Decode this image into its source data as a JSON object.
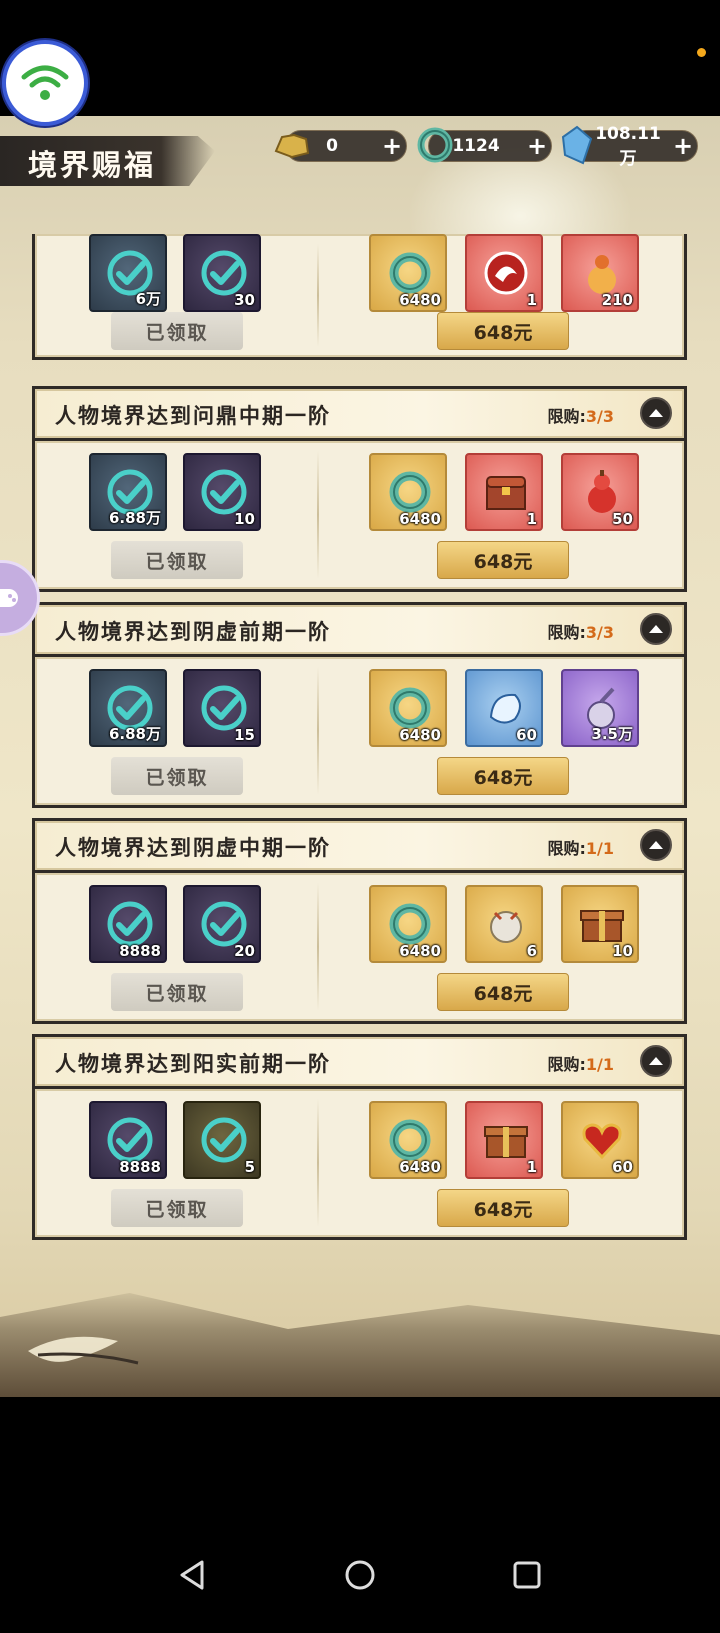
{
  "header": {
    "title": "境界赐福",
    "currencies": [
      {
        "name": "gold-ingot-icon",
        "value": "0",
        "plus": "+"
      },
      {
        "name": "jade-dragon-icon",
        "value": "1124",
        "plus": "+"
      },
      {
        "name": "spirit-crystal-icon",
        "value": "108.11万",
        "plus": "+"
      }
    ]
  },
  "cards": [
    {
      "title": "",
      "limit_label": "",
      "limit_value": "",
      "free_items": [
        {
          "name": "claimed-item-icon",
          "count": "6万",
          "style": "dark"
        },
        {
          "name": "claimed-item-icon",
          "count": "30",
          "style": "purple"
        }
      ],
      "claim_label": "已领取",
      "paid_items": [
        {
          "name": "jade-dragon-icon",
          "count": "6480",
          "style": "gold"
        },
        {
          "name": "dragon-emblem-icon",
          "count": "1",
          "style": "red"
        },
        {
          "name": "fire-gourd-icon",
          "count": "210",
          "style": "red"
        }
      ],
      "price": "648元"
    },
    {
      "title": "人物境界达到问鼎中期一阶",
      "limit_label": "限购:",
      "limit_value": "3/3",
      "free_items": [
        {
          "name": "claimed-item-icon",
          "count": "6.88万",
          "style": "dark"
        },
        {
          "name": "claimed-item-icon",
          "count": "10",
          "style": "purple"
        }
      ],
      "claim_label": "已领取",
      "paid_items": [
        {
          "name": "jade-dragon-icon",
          "count": "6480",
          "style": "gold"
        },
        {
          "name": "treasure-chest-icon",
          "count": "1",
          "style": "red"
        },
        {
          "name": "red-gourd-icon",
          "count": "50",
          "style": "red"
        }
      ],
      "price": "648元"
    },
    {
      "title": "人物境界达到阴虚前期一阶",
      "limit_label": "限购:",
      "limit_value": "3/3",
      "free_items": [
        {
          "name": "claimed-item-icon",
          "count": "6.88万",
          "style": "dark"
        },
        {
          "name": "claimed-item-icon",
          "count": "15",
          "style": "purple"
        }
      ],
      "claim_label": "已领取",
      "paid_items": [
        {
          "name": "jade-dragon-icon",
          "count": "6480",
          "style": "gold"
        },
        {
          "name": "blue-spirit-icon",
          "count": "60",
          "style": "blue"
        },
        {
          "name": "spirit-gourd-icon",
          "count": "3.5万",
          "style": "violet"
        }
      ],
      "price": "648元"
    },
    {
      "title": "人物境界达到阴虚中期一阶",
      "limit_label": "限购:",
      "limit_value": "1/1",
      "free_items": [
        {
          "name": "claimed-item-icon",
          "count": "8888",
          "style": "purple"
        },
        {
          "name": "claimed-item-icon",
          "count": "20",
          "style": "purple"
        }
      ],
      "claim_label": "已领取",
      "paid_items": [
        {
          "name": "jade-dragon-icon",
          "count": "6480",
          "style": "gold"
        },
        {
          "name": "beast-pouch-icon",
          "count": "6",
          "style": "gold"
        },
        {
          "name": "gift-box-icon",
          "count": "10",
          "style": "gold"
        }
      ],
      "price": "648元"
    },
    {
      "title": "人物境界达到阳实前期一阶",
      "limit_label": "限购:",
      "limit_value": "1/1",
      "free_items": [
        {
          "name": "claimed-item-icon",
          "count": "8888",
          "style": "purple"
        },
        {
          "name": "claimed-item-icon",
          "count": "5",
          "style": "olive"
        }
      ],
      "claim_label": "已领取",
      "paid_items": [
        {
          "name": "jade-dragon-icon",
          "count": "6480",
          "style": "gold"
        },
        {
          "name": "gift-box-icon",
          "count": "1",
          "style": "red"
        },
        {
          "name": "fire-heart-icon",
          "count": "60",
          "style": "gold"
        }
      ],
      "price": "648元"
    }
  ],
  "colors": {
    "accent": "#d46a1a",
    "button_gold": "#e6bf68",
    "frame": "#2e2a26"
  },
  "nav": {
    "back": "back-icon",
    "home": "home-icon",
    "recents": "recents-icon"
  }
}
